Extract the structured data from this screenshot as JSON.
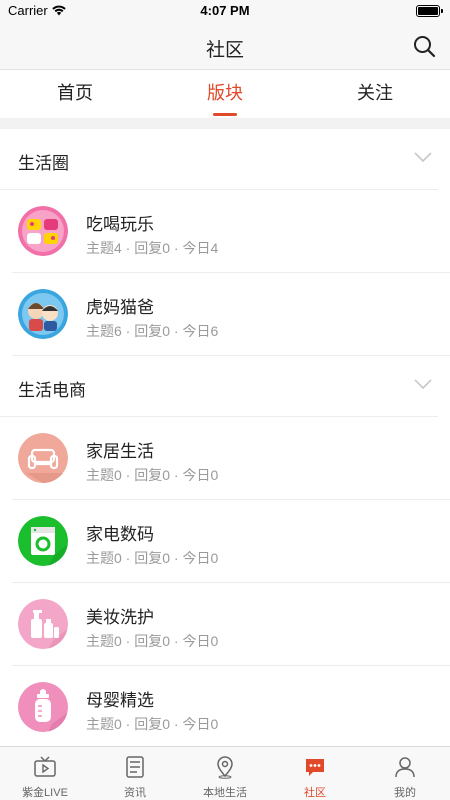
{
  "status_bar": {
    "carrier": "Carrier",
    "time": "4:07 PM"
  },
  "nav": {
    "title": "社区",
    "search_icon": "search-icon"
  },
  "tabs": [
    {
      "label": "首页",
      "active": false
    },
    {
      "label": "版块",
      "active": true
    },
    {
      "label": "关注",
      "active": false
    }
  ],
  "sections": [
    {
      "title": "生活圈",
      "forums": [
        {
          "name": "吃喝玩乐",
          "stats": "主题4 · 回复0 · 今日4",
          "icon": "food-fun-icon"
        },
        {
          "name": "虎妈猫爸",
          "stats": "主题6 · 回复0 · 今日6",
          "icon": "parents-icon"
        }
      ]
    },
    {
      "title": "生活电商",
      "forums": [
        {
          "name": "家居生活",
          "stats": "主题0 · 回复0 · 今日0",
          "icon": "sofa-icon"
        },
        {
          "name": "家电数码",
          "stats": "主题0 · 回复0 · 今日0",
          "icon": "washer-icon"
        },
        {
          "name": "美妆洗护",
          "stats": "主题0 · 回复0 · 今日0",
          "icon": "cosmetics-icon"
        },
        {
          "name": "母婴精选",
          "stats": "主题0 · 回复0 · 今日0",
          "icon": "baby-bottle-icon"
        }
      ]
    }
  ],
  "tabbar": [
    {
      "label": "紫金LIVE",
      "icon": "tv-icon",
      "active": false
    },
    {
      "label": "资讯",
      "icon": "news-list-icon",
      "active": false
    },
    {
      "label": "本地生活",
      "icon": "location-pin-icon",
      "active": false
    },
    {
      "label": "社区",
      "icon": "chat-bubble-icon",
      "active": true
    },
    {
      "label": "我的",
      "icon": "user-icon",
      "active": false
    }
  ],
  "colors": {
    "accent": "#e0492a",
    "muted_text": "#9a9a9a",
    "nav_bg": "#f7f7f7"
  }
}
